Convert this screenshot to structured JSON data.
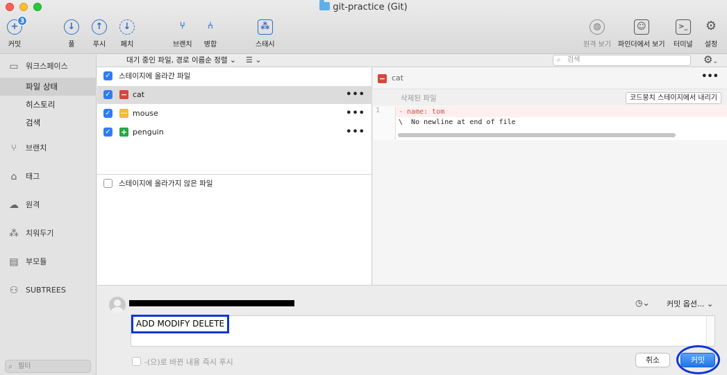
{
  "window": {
    "title": "git-practice (Git)"
  },
  "toolbar": {
    "commit": {
      "label": "커밋",
      "badge": "3"
    },
    "pull": "풀",
    "push": "푸시",
    "fetch": "페치",
    "branch": "브랜치",
    "merge": "병합",
    "stash": "스태시",
    "remote_view": "원격 보기",
    "show_in_finder": "파인더에서 보기",
    "terminal": "터미널",
    "settings": "설정"
  },
  "sidebar": {
    "workspace": "워크스페이스",
    "workspace_items": [
      "파일 상태",
      "히스토리",
      "검색"
    ],
    "active_item": "파일 상태",
    "branches": "브랜치",
    "tags": "태그",
    "remotes": "원격",
    "stashes": "치워두기",
    "submodules": "부모듈",
    "subtrees": "SUBTREES",
    "filter_placeholder": "필터"
  },
  "subbar": {
    "sort_label": "대기 중인 파일, 경로 이름순 정렬",
    "view_toggle_icon": "list-icon",
    "search_placeholder": "검색"
  },
  "files": {
    "staged_header": "스테이지에 올라간 파일",
    "staged": [
      {
        "name": "cat",
        "status": "deleted",
        "status_glyph": "−",
        "actions": "•••"
      },
      {
        "name": "mouse",
        "status": "modified",
        "status_glyph": "···",
        "actions": "•••"
      },
      {
        "name": "penguin",
        "status": "added",
        "status_glyph": "+",
        "actions": "•••"
      }
    ],
    "unstaged_header": "스테이지에 올라가지 않은 파일"
  },
  "diff": {
    "file": "cat",
    "menu": "•••",
    "hunk_label": "삭제된 파일",
    "unstage_hunk": "코드뭉치 스테이지에서 내리기",
    "lines": [
      {
        "num": "1",
        "text": "- name: tom"
      },
      {
        "num": "",
        "text": "\\  No newline at end of file"
      }
    ]
  },
  "commit": {
    "history_icon": "◷⌄",
    "options": "커밋 옵션...",
    "message": "ADD MODIFY DELETE",
    "push_immediately": "-(으)로 바뀐 내용 즉시 푸시",
    "cancel": "취소",
    "submit": "커밋"
  },
  "colors": {
    "accent": "#2e7cf6",
    "deleted": "#d9443d",
    "modified": "#f2b943",
    "added": "#28a745",
    "annotation": "#0b36d6"
  }
}
